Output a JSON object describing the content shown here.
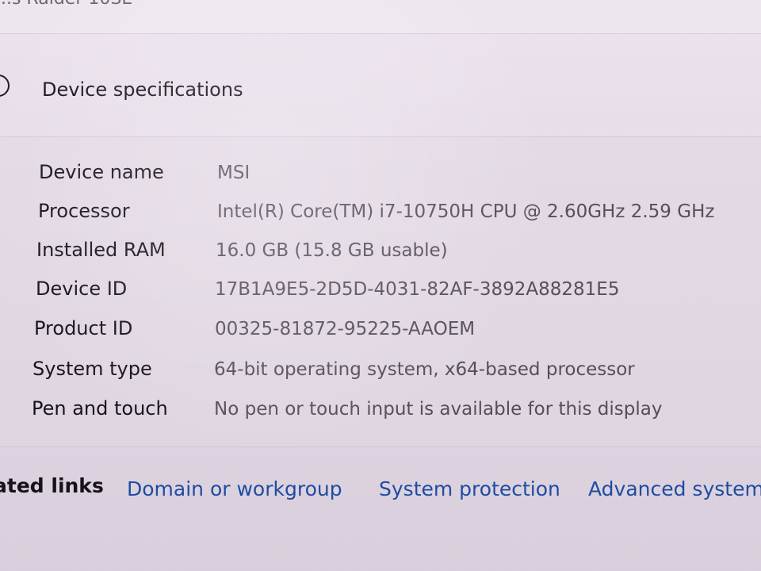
{
  "window": {
    "top_partial_text": "...s Raider 10SE"
  },
  "section": {
    "title": "Device specifications"
  },
  "specs": {
    "device_name_label": "Device name",
    "device_name_value": "MSI",
    "processor_label": "Processor",
    "processor_value": "Intel(R) Core(TM) i7-10750H CPU @ 2.60GHz   2.59 GHz",
    "ram_label": "Installed RAM",
    "ram_value": "16.0 GB (15.8 GB usable)",
    "device_id_label": "Device ID",
    "device_id_value": "17B1A9E5-2D5D-4031-82AF-3892A88281E5",
    "product_id_label": "Product ID",
    "product_id_value": "00325-81872-95225-AAOEM",
    "system_type_label": "System type",
    "system_type_value": "64-bit operating system, x64-based processor",
    "pen_touch_label": "Pen and touch",
    "pen_touch_value": "No pen or touch input is available for this display"
  },
  "related": {
    "label": "ated links",
    "links": [
      "Domain or workgroup",
      "System protection",
      "Advanced system s"
    ]
  }
}
